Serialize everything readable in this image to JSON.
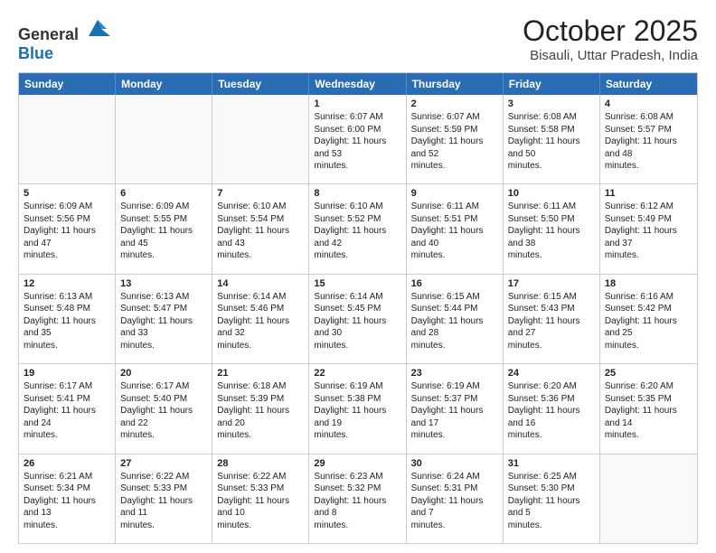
{
  "header": {
    "logo_general": "General",
    "logo_blue": "Blue",
    "month": "October 2025",
    "location": "Bisauli, Uttar Pradesh, India"
  },
  "days_of_week": [
    "Sunday",
    "Monday",
    "Tuesday",
    "Wednesday",
    "Thursday",
    "Friday",
    "Saturday"
  ],
  "weeks": [
    [
      {
        "day": "",
        "empty": true
      },
      {
        "day": "",
        "empty": true
      },
      {
        "day": "",
        "empty": true
      },
      {
        "day": "1",
        "sunrise": "6:07 AM",
        "sunset": "6:00 PM",
        "daylight": "11 hours and 53 minutes."
      },
      {
        "day": "2",
        "sunrise": "6:07 AM",
        "sunset": "5:59 PM",
        "daylight": "11 hours and 52 minutes."
      },
      {
        "day": "3",
        "sunrise": "6:08 AM",
        "sunset": "5:58 PM",
        "daylight": "11 hours and 50 minutes."
      },
      {
        "day": "4",
        "sunrise": "6:08 AM",
        "sunset": "5:57 PM",
        "daylight": "11 hours and 48 minutes."
      }
    ],
    [
      {
        "day": "5",
        "sunrise": "6:09 AM",
        "sunset": "5:56 PM",
        "daylight": "11 hours and 47 minutes."
      },
      {
        "day": "6",
        "sunrise": "6:09 AM",
        "sunset": "5:55 PM",
        "daylight": "11 hours and 45 minutes."
      },
      {
        "day": "7",
        "sunrise": "6:10 AM",
        "sunset": "5:54 PM",
        "daylight": "11 hours and 43 minutes."
      },
      {
        "day": "8",
        "sunrise": "6:10 AM",
        "sunset": "5:52 PM",
        "daylight": "11 hours and 42 minutes."
      },
      {
        "day": "9",
        "sunrise": "6:11 AM",
        "sunset": "5:51 PM",
        "daylight": "11 hours and 40 minutes."
      },
      {
        "day": "10",
        "sunrise": "6:11 AM",
        "sunset": "5:50 PM",
        "daylight": "11 hours and 38 minutes."
      },
      {
        "day": "11",
        "sunrise": "6:12 AM",
        "sunset": "5:49 PM",
        "daylight": "11 hours and 37 minutes."
      }
    ],
    [
      {
        "day": "12",
        "sunrise": "6:13 AM",
        "sunset": "5:48 PM",
        "daylight": "11 hours and 35 minutes."
      },
      {
        "day": "13",
        "sunrise": "6:13 AM",
        "sunset": "5:47 PM",
        "daylight": "11 hours and 33 minutes."
      },
      {
        "day": "14",
        "sunrise": "6:14 AM",
        "sunset": "5:46 PM",
        "daylight": "11 hours and 32 minutes."
      },
      {
        "day": "15",
        "sunrise": "6:14 AM",
        "sunset": "5:45 PM",
        "daylight": "11 hours and 30 minutes."
      },
      {
        "day": "16",
        "sunrise": "6:15 AM",
        "sunset": "5:44 PM",
        "daylight": "11 hours and 28 minutes."
      },
      {
        "day": "17",
        "sunrise": "6:15 AM",
        "sunset": "5:43 PM",
        "daylight": "11 hours and 27 minutes."
      },
      {
        "day": "18",
        "sunrise": "6:16 AM",
        "sunset": "5:42 PM",
        "daylight": "11 hours and 25 minutes."
      }
    ],
    [
      {
        "day": "19",
        "sunrise": "6:17 AM",
        "sunset": "5:41 PM",
        "daylight": "11 hours and 24 minutes."
      },
      {
        "day": "20",
        "sunrise": "6:17 AM",
        "sunset": "5:40 PM",
        "daylight": "11 hours and 22 minutes."
      },
      {
        "day": "21",
        "sunrise": "6:18 AM",
        "sunset": "5:39 PM",
        "daylight": "11 hours and 20 minutes."
      },
      {
        "day": "22",
        "sunrise": "6:19 AM",
        "sunset": "5:38 PM",
        "daylight": "11 hours and 19 minutes."
      },
      {
        "day": "23",
        "sunrise": "6:19 AM",
        "sunset": "5:37 PM",
        "daylight": "11 hours and 17 minutes."
      },
      {
        "day": "24",
        "sunrise": "6:20 AM",
        "sunset": "5:36 PM",
        "daylight": "11 hours and 16 minutes."
      },
      {
        "day": "25",
        "sunrise": "6:20 AM",
        "sunset": "5:35 PM",
        "daylight": "11 hours and 14 minutes."
      }
    ],
    [
      {
        "day": "26",
        "sunrise": "6:21 AM",
        "sunset": "5:34 PM",
        "daylight": "11 hours and 13 minutes."
      },
      {
        "day": "27",
        "sunrise": "6:22 AM",
        "sunset": "5:33 PM",
        "daylight": "11 hours and 11 minutes."
      },
      {
        "day": "28",
        "sunrise": "6:22 AM",
        "sunset": "5:33 PM",
        "daylight": "11 hours and 10 minutes."
      },
      {
        "day": "29",
        "sunrise": "6:23 AM",
        "sunset": "5:32 PM",
        "daylight": "11 hours and 8 minutes."
      },
      {
        "day": "30",
        "sunrise": "6:24 AM",
        "sunset": "5:31 PM",
        "daylight": "11 hours and 7 minutes."
      },
      {
        "day": "31",
        "sunrise": "6:25 AM",
        "sunset": "5:30 PM",
        "daylight": "11 hours and 5 minutes."
      },
      {
        "day": "",
        "empty": true
      }
    ]
  ]
}
